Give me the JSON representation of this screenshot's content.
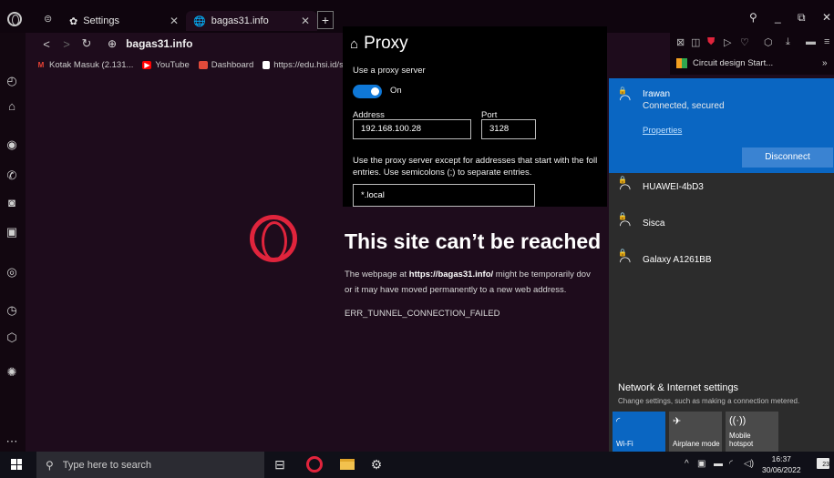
{
  "browser": {
    "tabs": [
      {
        "label": "Settings",
        "icon": "gear-icon"
      },
      {
        "label": "bagas31.info",
        "icon": "globe-icon"
      }
    ],
    "address": "bagas31.info",
    "bookmarks": [
      {
        "label": "Kotak Masuk (2.131...",
        "icon": "gmail-icon",
        "color": "#ea4335"
      },
      {
        "label": "YouTube",
        "icon": "youtube-icon",
        "color": "#ff0000"
      },
      {
        "label": "Dashboard",
        "icon": "dashboard-icon",
        "color": "#e04a3a"
      },
      {
        "label": "https://edu.hsi.id/st...",
        "icon": "page-icon",
        "color": "#ffffff"
      }
    ],
    "right_bookmark": "Circuit design Start...",
    "more_bookmarks": "»"
  },
  "error_page": {
    "title": "This site can’t be reached",
    "msg_prefix": "The webpage at ",
    "msg_url": "https://bagas31.info/",
    "msg_line1_rest": " might be temporarily dov",
    "msg_line2": "or it may have moved permanently to a new web address.",
    "code": "ERR_TUNNEL_CONNECTION_FAILED"
  },
  "proxy": {
    "title": "Proxy",
    "use_proxy_label": "Use a proxy server",
    "toggle_state": "On",
    "address_label": "Address",
    "address_value": "192.168.100.28",
    "port_label": "Port",
    "port_value": "3128",
    "exceptions_line1": "Use the proxy server except for addresses that start with the foll",
    "exceptions_line2": "entries. Use semicolons (;) to separate entries.",
    "exceptions_value": "*.local"
  },
  "network": {
    "connected": {
      "name": "Irawan",
      "status": "Connected, secured",
      "properties": "Properties",
      "action": "Disconnect"
    },
    "others": [
      "HUAWEI-4bD3",
      "Sisca",
      "Galaxy A1261BB"
    ],
    "settings_title": "Network & Internet settings",
    "settings_sub": "Change settings, such as making a connection metered.",
    "tiles": [
      {
        "label": "Wi-Fi",
        "icon": "wifi-icon",
        "active": true
      },
      {
        "label": "Airplane mode",
        "icon": "airplane-icon",
        "active": false
      },
      {
        "label": "Mobile\nhotspot",
        "icon": "hotspot-icon",
        "active": false
      }
    ]
  },
  "taskbar": {
    "search_placeholder": "Type here to search",
    "time": "16:37",
    "date": "30/06/2022",
    "notification_count": "23"
  },
  "colors": {
    "opera_red": "#e0243c",
    "accent_blue": "#0a66c2",
    "browser_bg": "#1e0c1c"
  }
}
